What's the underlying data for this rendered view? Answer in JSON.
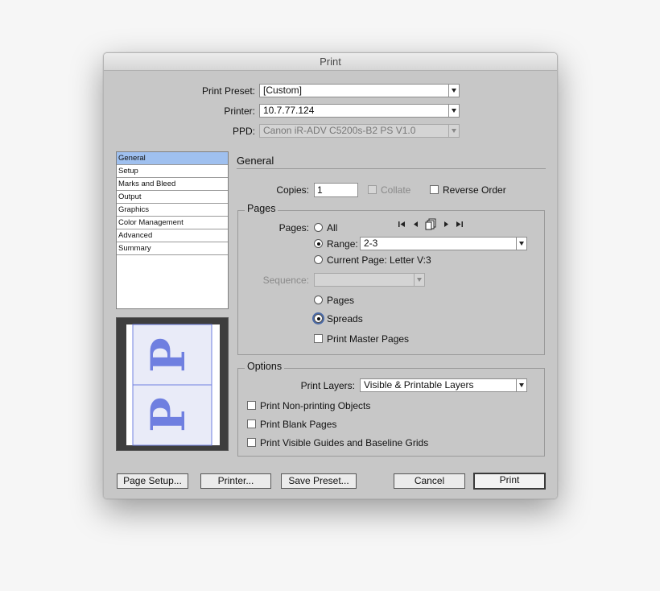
{
  "window": {
    "title": "Print"
  },
  "header": {
    "print_preset_label": "Print Preset:",
    "print_preset_value": "[Custom]",
    "printer_label": "Printer:",
    "printer_value": "10.7.77.124",
    "ppd_label": "PPD:",
    "ppd_value": "Canon iR-ADV C5200s-B2 PS V1.0"
  },
  "sidebar": {
    "items": [
      {
        "label": "General",
        "selected": true
      },
      {
        "label": "Setup"
      },
      {
        "label": "Marks and Bleed"
      },
      {
        "label": "Output"
      },
      {
        "label": "Graphics"
      },
      {
        "label": "Color Management"
      },
      {
        "label": "Advanced"
      },
      {
        "label": "Summary"
      }
    ]
  },
  "preview": {
    "glyph": "P",
    "accent": "#6f7fe0"
  },
  "general": {
    "section_title": "General",
    "copies_label": "Copies:",
    "copies_value": "1",
    "collate_label": "Collate",
    "collate_checked": false,
    "collate_disabled": true,
    "reverse_order_label": "Reverse Order",
    "reverse_order_checked": false
  },
  "pages_group": {
    "title": "Pages",
    "pages_label": "Pages:",
    "all_label": "All",
    "range_label": "Range:",
    "range_value": "2-3",
    "current_page_label": "Current Page: Letter V:3",
    "sequence_label": "Sequence:",
    "sequence_value": "",
    "pages_radio_label": "Pages",
    "spreads_radio_label": "Spreads",
    "print_master_pages_label": "Print Master Pages",
    "selected_range": "range",
    "selected_layout": "spreads"
  },
  "options_group": {
    "title": "Options",
    "print_layers_label": "Print Layers:",
    "print_layers_value": "Visible & Printable Layers",
    "non_printing_label": "Print Non-printing Objects",
    "blank_pages_label": "Print Blank Pages",
    "guides_label": "Print Visible Guides and Baseline Grids"
  },
  "buttons": {
    "page_setup": "Page Setup...",
    "printer": "Printer...",
    "save_preset": "Save Preset...",
    "cancel": "Cancel",
    "print": "Print"
  },
  "colors": {
    "selection": "#9fc0ef",
    "dialog_bg": "#c7c7c7"
  },
  "icons": {
    "nav": [
      "first-page-icon",
      "prev-page-icon",
      "spreads-icon",
      "next-page-icon",
      "last-page-icon"
    ]
  }
}
